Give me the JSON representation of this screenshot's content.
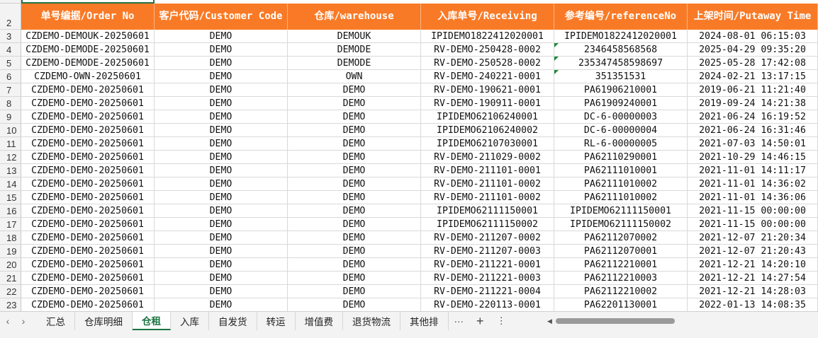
{
  "header": {
    "row_number": "2",
    "columns": [
      "单号编据/Order No",
      "客户代码/Customer Code",
      "仓库/warehouse",
      "入库单号/Receiving",
      "参考编号/referenceNo",
      "上架时间/Putaway Time"
    ]
  },
  "rows": [
    {
      "n": "3",
      "order": "CZDEMO-DEMOUK-20250601",
      "customer": "DEMO",
      "warehouse": "DEMOUK",
      "receiving": "IPIDEMO1822412020001",
      "reference": "IPIDEMO1822412020001",
      "time": "2024-08-01 06:15:03",
      "flag": false
    },
    {
      "n": "4",
      "order": "CZDEMO-DEMODE-20250601",
      "customer": "DEMO",
      "warehouse": "DEMODE",
      "receiving": "RV-DEMO-250428-0002",
      "reference": "2346458568568",
      "time": "2025-04-29 09:35:20",
      "flag": true
    },
    {
      "n": "5",
      "order": "CZDEMO-DEMODE-20250601",
      "customer": "DEMO",
      "warehouse": "DEMODE",
      "receiving": "RV-DEMO-250528-0002",
      "reference": "235347458598697",
      "time": "2025-05-28 17:42:08",
      "flag": true
    },
    {
      "n": "6",
      "order": "CZDEMO-OWN-20250601",
      "customer": "DEMO",
      "warehouse": "OWN",
      "receiving": "RV-DEMO-240221-0001",
      "reference": "351351531",
      "time": "2024-02-21 13:17:15",
      "flag": true
    },
    {
      "n": "7",
      "order": "CZDEMO-DEMO-20250601",
      "customer": "DEMO",
      "warehouse": "DEMO",
      "receiving": "RV-DEMO-190621-0001",
      "reference": "PA61906210001",
      "time": "2019-06-21 11:21:40",
      "flag": false
    },
    {
      "n": "8",
      "order": "CZDEMO-DEMO-20250601",
      "customer": "DEMO",
      "warehouse": "DEMO",
      "receiving": "RV-DEMO-190911-0001",
      "reference": "PA61909240001",
      "time": "2019-09-24 14:21:38",
      "flag": false
    },
    {
      "n": "9",
      "order": "CZDEMO-DEMO-20250601",
      "customer": "DEMO",
      "warehouse": "DEMO",
      "receiving": "IPIDEMO62106240001",
      "reference": "DC-6-00000003",
      "time": "2021-06-24 16:19:52",
      "flag": false
    },
    {
      "n": "10",
      "order": "CZDEMO-DEMO-20250601",
      "customer": "DEMO",
      "warehouse": "DEMO",
      "receiving": "IPIDEMO62106240002",
      "reference": "DC-6-00000004",
      "time": "2021-06-24 16:31:46",
      "flag": false
    },
    {
      "n": "11",
      "order": "CZDEMO-DEMO-20250601",
      "customer": "DEMO",
      "warehouse": "DEMO",
      "receiving": "IPIDEMO62107030001",
      "reference": "RL-6-00000005",
      "time": "2021-07-03 14:50:01",
      "flag": false
    },
    {
      "n": "12",
      "order": "CZDEMO-DEMO-20250601",
      "customer": "DEMO",
      "warehouse": "DEMO",
      "receiving": "RV-DEMO-211029-0002",
      "reference": "PA62110290001",
      "time": "2021-10-29 14:46:15",
      "flag": false
    },
    {
      "n": "13",
      "order": "CZDEMO-DEMO-20250601",
      "customer": "DEMO",
      "warehouse": "DEMO",
      "receiving": "RV-DEMO-211101-0001",
      "reference": "PA62111010001",
      "time": "2021-11-01 14:11:17",
      "flag": false
    },
    {
      "n": "14",
      "order": "CZDEMO-DEMO-20250601",
      "customer": "DEMO",
      "warehouse": "DEMO",
      "receiving": "RV-DEMO-211101-0002",
      "reference": "PA62111010002",
      "time": "2021-11-01 14:36:02",
      "flag": false
    },
    {
      "n": "15",
      "order": "CZDEMO-DEMO-20250601",
      "customer": "DEMO",
      "warehouse": "DEMO",
      "receiving": "RV-DEMO-211101-0002",
      "reference": "PA62111010002",
      "time": "2021-11-01 14:36:06",
      "flag": false
    },
    {
      "n": "16",
      "order": "CZDEMO-DEMO-20250601",
      "customer": "DEMO",
      "warehouse": "DEMO",
      "receiving": "IPIDEMO62111150001",
      "reference": "IPIDEMO62111150001",
      "time": "2021-11-15 00:00:00",
      "flag": false
    },
    {
      "n": "17",
      "order": "CZDEMO-DEMO-20250601",
      "customer": "DEMO",
      "warehouse": "DEMO",
      "receiving": "IPIDEMO62111150002",
      "reference": "IPIDEMO62111150002",
      "time": "2021-11-15 00:00:00",
      "flag": false
    },
    {
      "n": "18",
      "order": "CZDEMO-DEMO-20250601",
      "customer": "DEMO",
      "warehouse": "DEMO",
      "receiving": "RV-DEMO-211207-0002",
      "reference": "PA62112070002",
      "time": "2021-12-07 21:20:34",
      "flag": false
    },
    {
      "n": "19",
      "order": "CZDEMO-DEMO-20250601",
      "customer": "DEMO",
      "warehouse": "DEMO",
      "receiving": "RV-DEMO-211207-0003",
      "reference": "PA62112070001",
      "time": "2021-12-07 21:20:43",
      "flag": false
    },
    {
      "n": "20",
      "order": "CZDEMO-DEMO-20250601",
      "customer": "DEMO",
      "warehouse": "DEMO",
      "receiving": "RV-DEMO-211221-0001",
      "reference": "PA62112210001",
      "time": "2021-12-21 14:20:10",
      "flag": false
    },
    {
      "n": "21",
      "order": "CZDEMO-DEMO-20250601",
      "customer": "DEMO",
      "warehouse": "DEMO",
      "receiving": "RV-DEMO-211221-0003",
      "reference": "PA62112210003",
      "time": "2021-12-21 14:27:54",
      "flag": false
    },
    {
      "n": "22",
      "order": "CZDEMO-DEMO-20250601",
      "customer": "DEMO",
      "warehouse": "DEMO",
      "receiving": "RV-DEMO-211221-0004",
      "reference": "PA62112210002",
      "time": "2021-12-21 14:28:03",
      "flag": false
    },
    {
      "n": "23",
      "order": "CZDEMO-DEMO-20250601",
      "customer": "DEMO",
      "warehouse": "DEMO",
      "receiving": "RV-DEMO-220113-0001",
      "reference": "PA62201130001",
      "time": "2022-01-13 14:08:35",
      "flag": false
    }
  ],
  "tabs": [
    "汇总",
    "仓库明细",
    "仓租",
    "入库",
    "自发货",
    "转运",
    "增值费",
    "退货物流",
    "其他排"
  ],
  "active_tab": "仓租",
  "tab_more": "···",
  "tab_add": "+",
  "tab_menu": "⋮",
  "nav_prev": "‹",
  "nav_next": "›",
  "colors": {
    "header_bg": "#f97a26",
    "active_tab": "#1a7340",
    "flag": "#1e8a3a"
  }
}
